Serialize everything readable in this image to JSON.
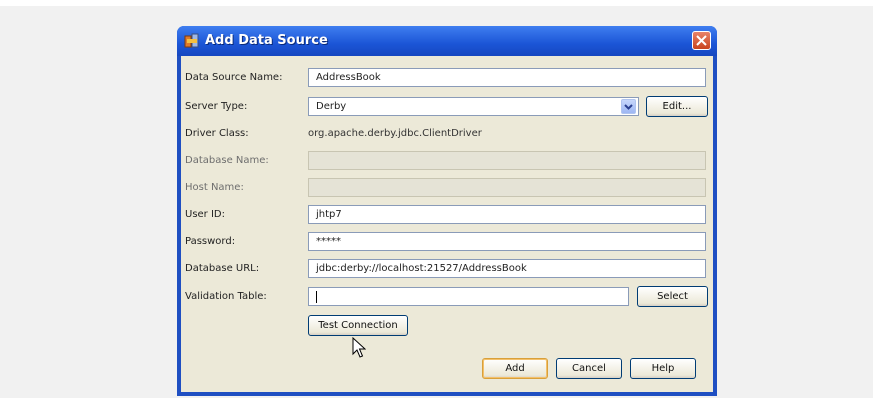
{
  "dialog": {
    "title": "Add Data Source",
    "fields": {
      "data_source_name": {
        "label": "Data Source Name:",
        "value": "AddressBook"
      },
      "server_type": {
        "label": "Server Type:",
        "value": "Derby",
        "edit_label": "Edit..."
      },
      "driver_class": {
        "label": "Driver Class:",
        "value": "org.apache.derby.jdbc.ClientDriver"
      },
      "database_name": {
        "label": "Database Name:",
        "value": ""
      },
      "host_name": {
        "label": "Host Name:",
        "value": ""
      },
      "user_id": {
        "label": "User ID:",
        "value": "jhtp7"
      },
      "password": {
        "label": "Password:",
        "value": "*****"
      },
      "database_url": {
        "label": "Database URL:",
        "value": "jdbc:derby://localhost:21527/AddressBook"
      },
      "validation_table": {
        "label": "Validation Table:",
        "value": "",
        "select_label": "Select"
      }
    },
    "buttons": {
      "test_connection": "Test Connection",
      "add": "Add",
      "cancel": "Cancel",
      "help": "Help"
    }
  },
  "icons": [
    "app-icon",
    "close-icon",
    "chevron-down-icon",
    "mouse-pointer-icon"
  ]
}
